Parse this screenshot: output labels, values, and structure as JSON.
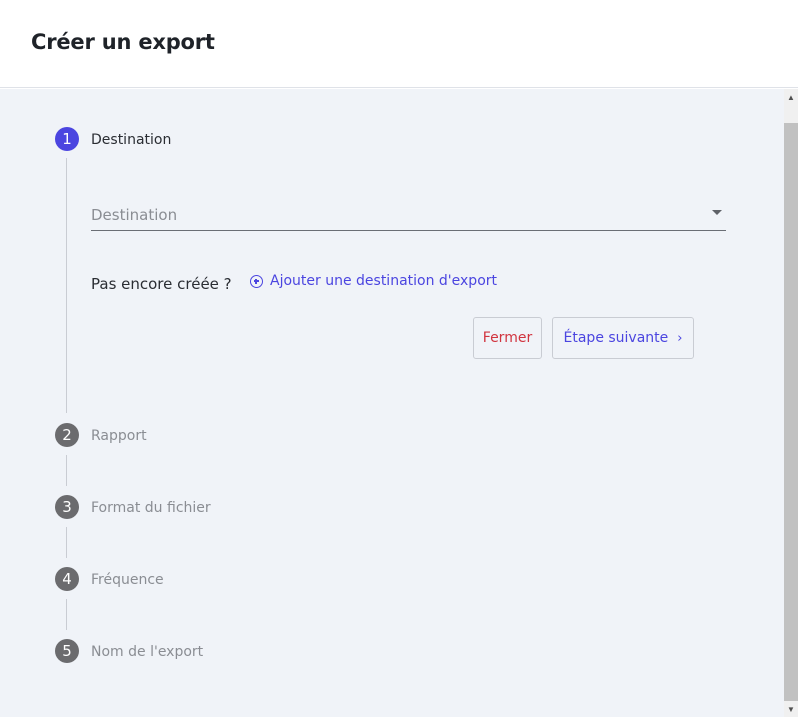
{
  "dialog": {
    "title": "Créer un export"
  },
  "steps": [
    {
      "number": "1",
      "label": "Destination",
      "state": "active"
    },
    {
      "number": "2",
      "label": "Rapport",
      "state": "inactive"
    },
    {
      "number": "3",
      "label": "Format du fichier",
      "state": "inactive"
    },
    {
      "number": "4",
      "label": "Fréquence",
      "state": "inactive"
    },
    {
      "number": "5",
      "label": "Nom de l'export",
      "state": "inactive"
    }
  ],
  "destination_step": {
    "select_placeholder": "Destination",
    "not_created_text": "Pas encore créée ?",
    "add_destination_link": "Ajouter une destination d'export",
    "close_button": "Fermer",
    "next_button": "Étape suivante",
    "next_icon": "chevron-right-icon"
  },
  "colors": {
    "accent": "#4b45e0",
    "danger": "#d1343f",
    "inactive_step": "#6b6b6e",
    "panel_background": "#f0f3f8"
  }
}
